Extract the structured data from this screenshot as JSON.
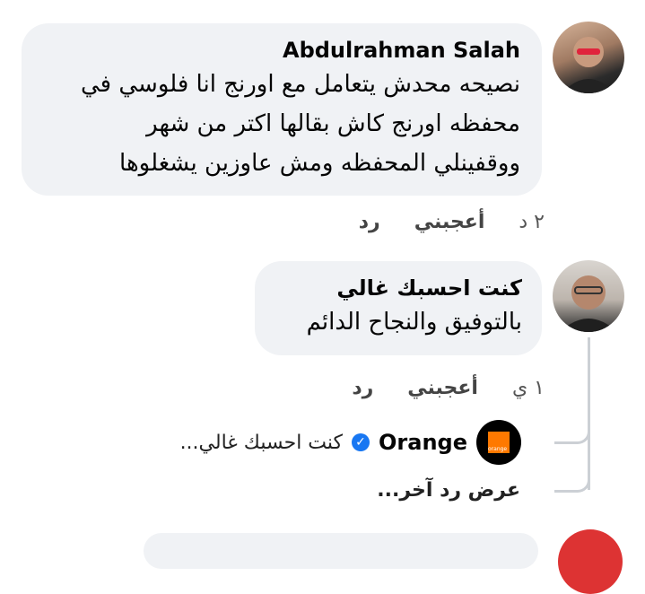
{
  "comments": [
    {
      "author": "Abdulrahman Salah",
      "lines": [
        "نصيحه محدش يتعامل مع اورنج انا فلوسي في",
        "محفظه اورنج كاش بقالها اكتر من شهر",
        "ووقفينلي المحفظه ومش عاوزين يشغلوها"
      ],
      "time": "٢ د",
      "like_label": "أعجبني",
      "reply_label": "رد"
    },
    {
      "author": "كنت احسبك غالي",
      "lines": [
        "بالتوفيق والنجاح الدائم"
      ],
      "time": "١ ي",
      "like_label": "أعجبني",
      "reply_label": "رد"
    }
  ],
  "nested_reply": {
    "author": "Orange",
    "avatar_text": "orange",
    "preview": "كنت احسبك غالي...",
    "brand_color": "#ff7900"
  },
  "more_replies_label": "عرض رد آخر...",
  "colors": {
    "bubble": "#f0f2f5",
    "verified": "#1877f2",
    "thread_line": "#ccd0d5"
  }
}
